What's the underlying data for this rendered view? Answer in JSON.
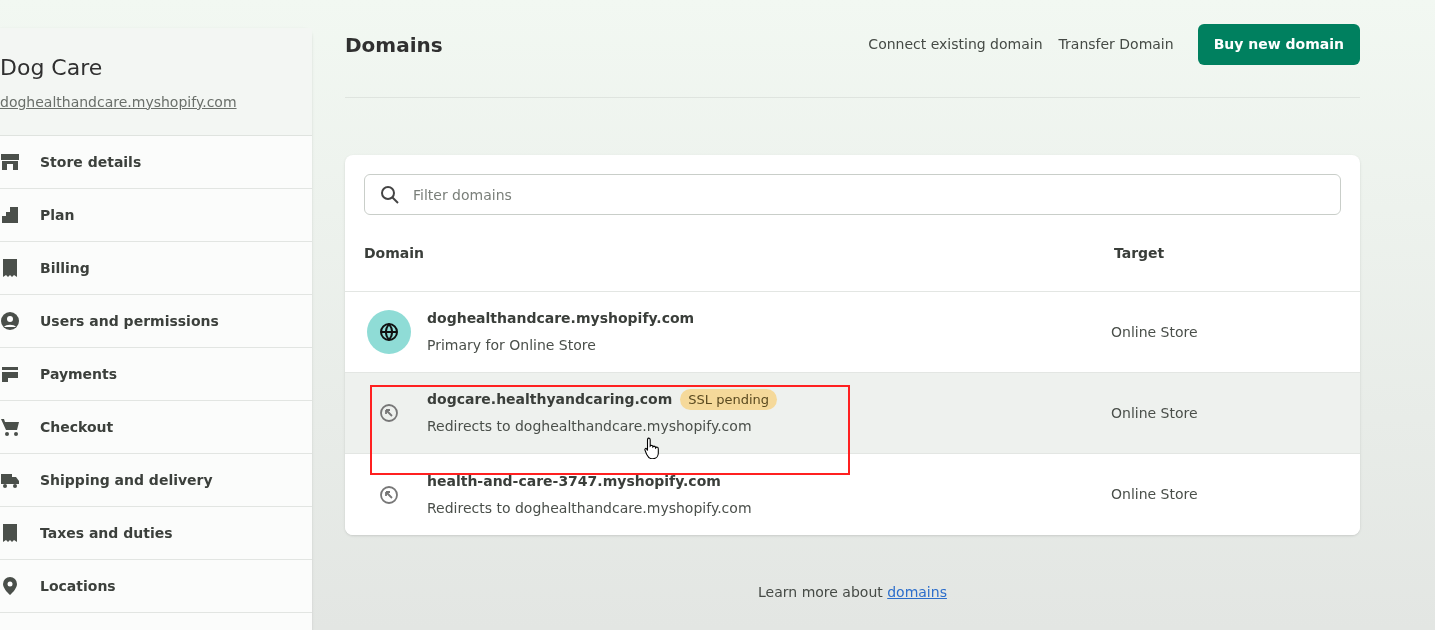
{
  "store": {
    "name": "Dog Care",
    "url": "doghealthandcare.myshopify.com"
  },
  "sidebar": {
    "items": [
      {
        "label": "Store details",
        "kind": "store"
      },
      {
        "label": "Plan",
        "kind": "plan"
      },
      {
        "label": "Billing",
        "kind": "billing"
      },
      {
        "label": "Users and permissions",
        "kind": "user"
      },
      {
        "label": "Payments",
        "kind": "payments"
      },
      {
        "label": "Checkout",
        "kind": "cart"
      },
      {
        "label": "Shipping and delivery",
        "kind": "truck"
      },
      {
        "label": "Taxes and duties",
        "kind": "tax"
      },
      {
        "label": "Locations",
        "kind": "pin"
      }
    ]
  },
  "page": {
    "title": "Domains",
    "actions": [
      {
        "label": "Connect existing domain",
        "kind": "link"
      },
      {
        "label": "Transfer Domain",
        "kind": "link"
      },
      {
        "label": "Buy new domain",
        "kind": "primary"
      }
    ]
  },
  "domains": {
    "search": {
      "placeholder": "Filter domains"
    },
    "columns": [
      "Domain",
      "Target"
    ],
    "rows": [
      {
        "kind": "primary",
        "domain": "doghealthandcare.myshopify.com",
        "note": "Primary for Online Store",
        "target": "Online Store",
        "highlighted": false,
        "annotated": false
      },
      {
        "kind": "redirect",
        "domain": "dogcare.healthyandcaring.com",
        "badge": "SSL pending",
        "note": "Redirects to doghealthandcare.myshopify.com",
        "target": "Online Store",
        "highlighted": true,
        "annotated": true
      },
      {
        "kind": "redirect",
        "domain": "health-and-care-3747.myshopify.com",
        "note": "Redirects to doghealthandcare.myshopify.com",
        "target": "Online Store",
        "highlighted": false,
        "annotated": false
      }
    ]
  },
  "footer": {
    "text": "Learn more about ",
    "link": "domains"
  }
}
